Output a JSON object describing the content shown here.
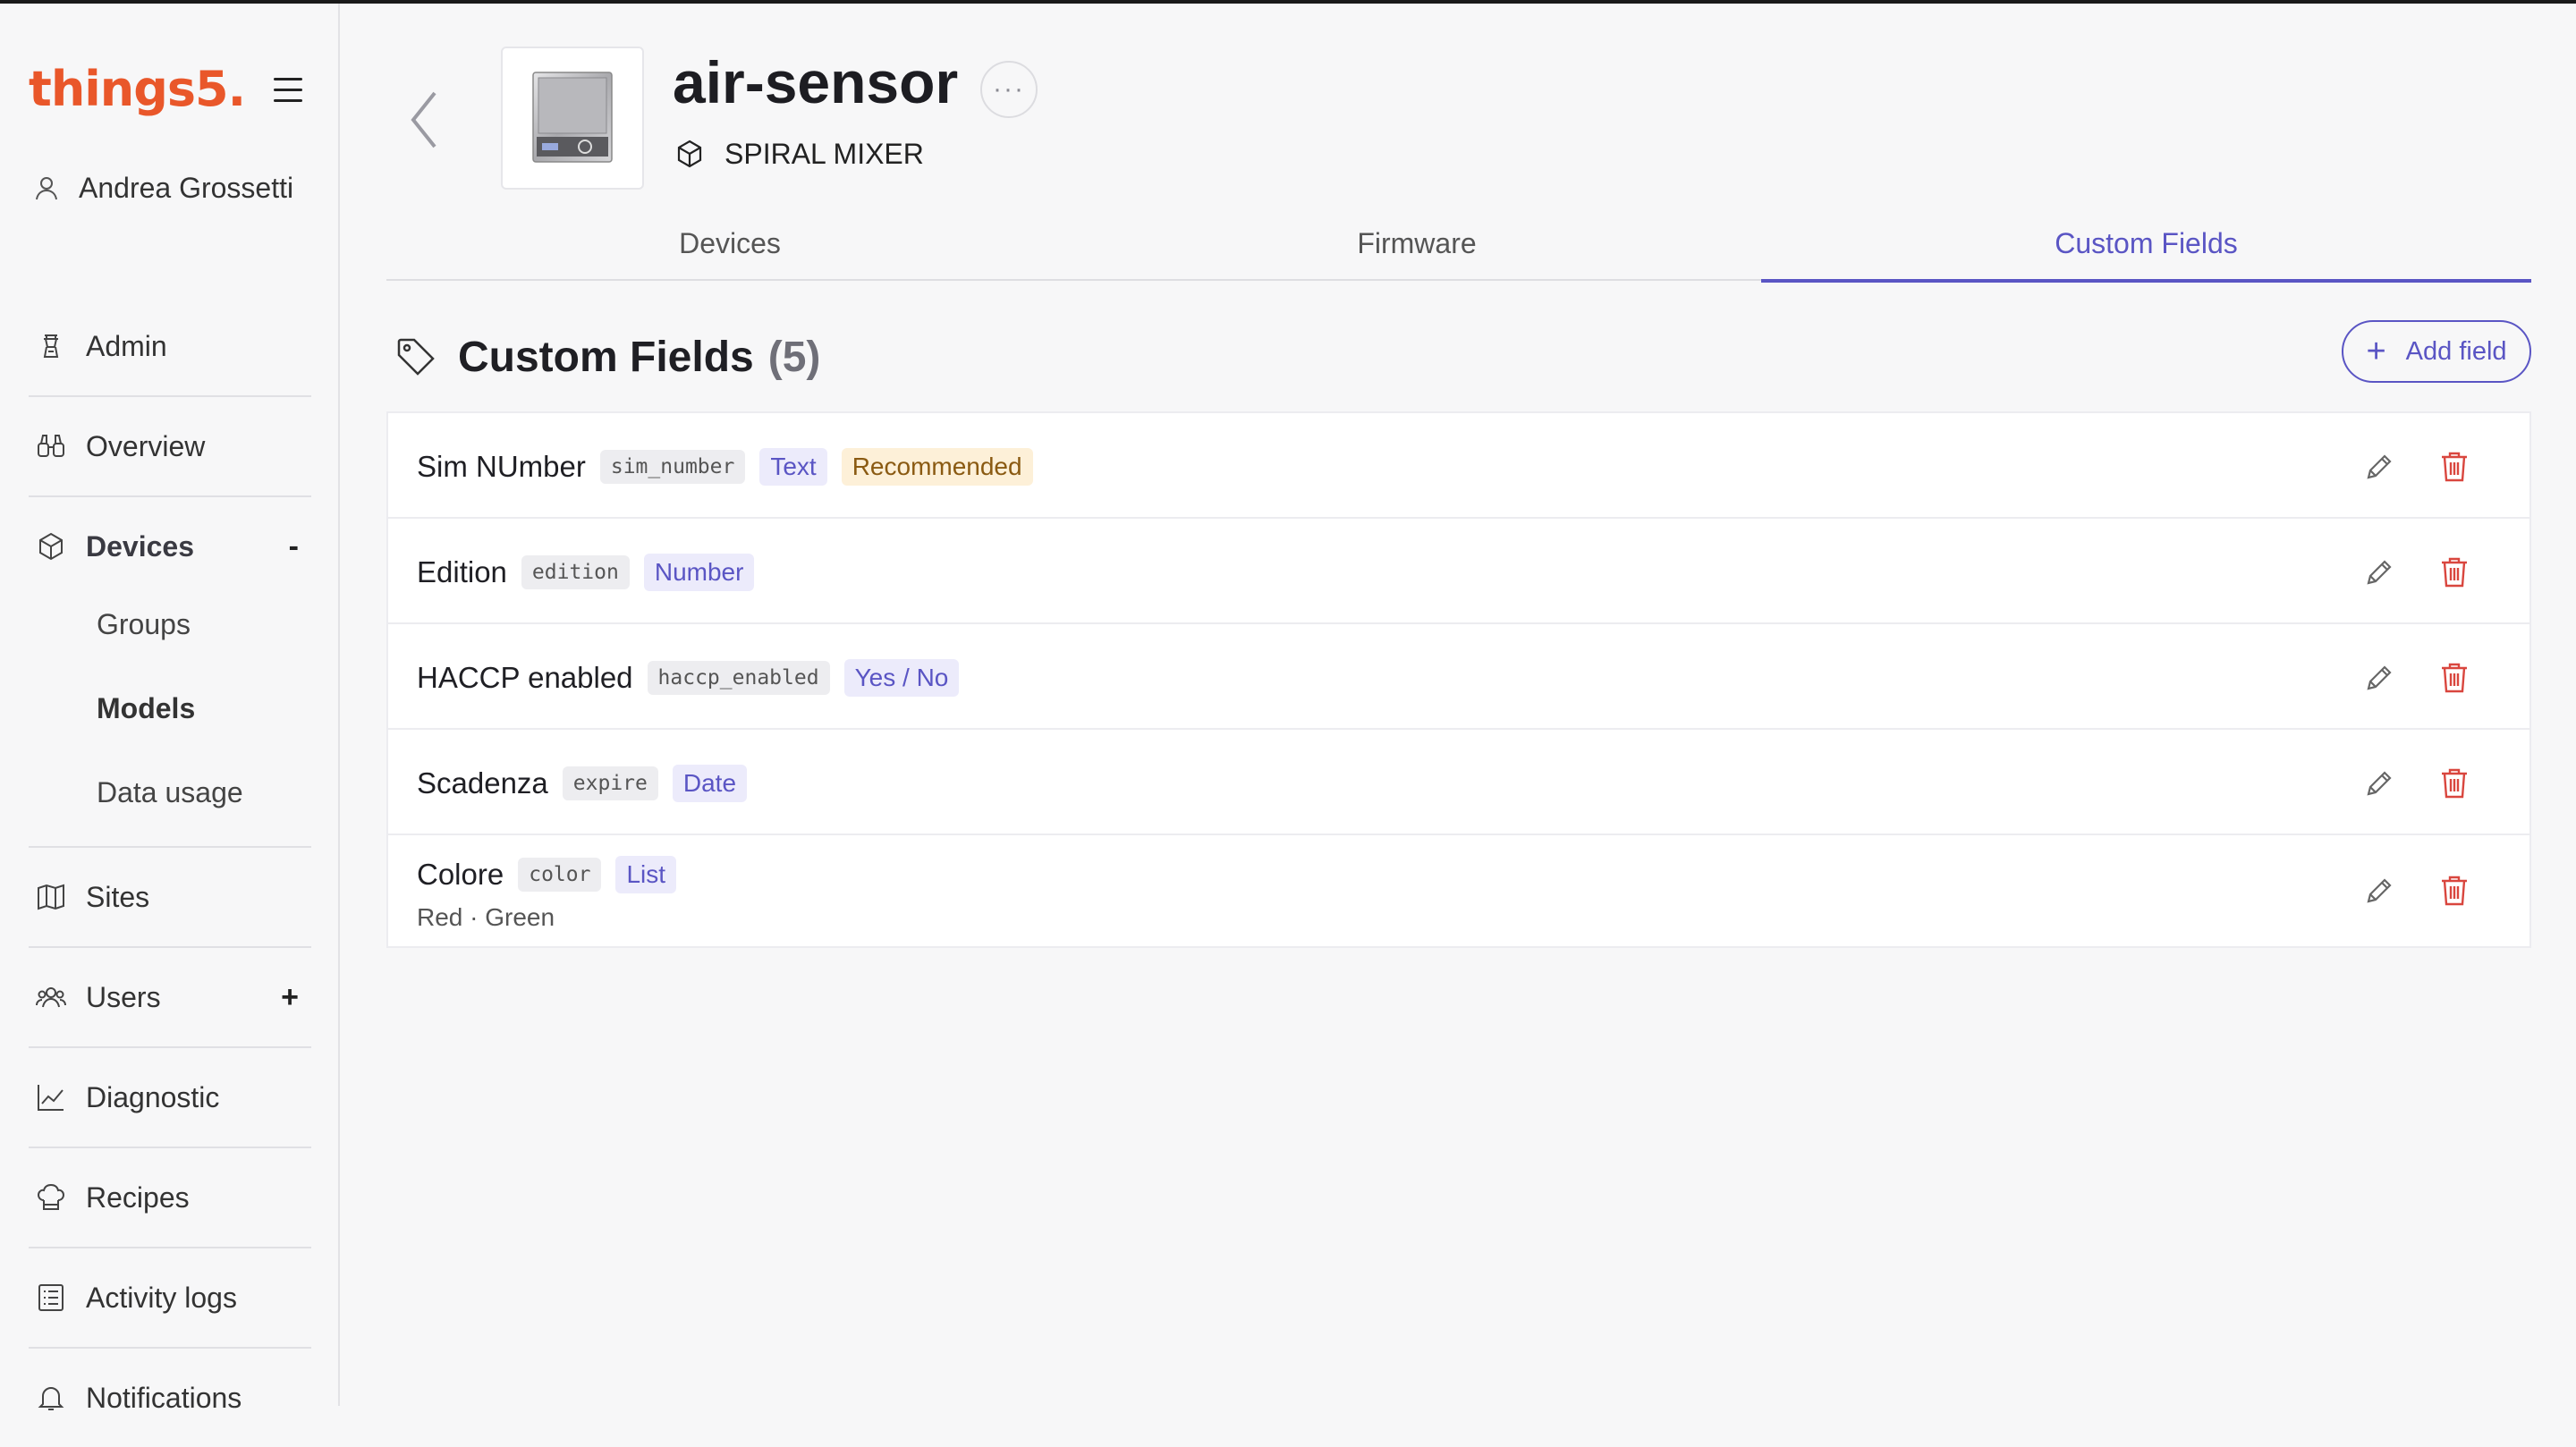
{
  "brand": {
    "logo_text": "things5.",
    "accent": "#e9572a"
  },
  "user": {
    "name": "Andrea Grossetti"
  },
  "nav": {
    "admin": "Admin",
    "overview": "Overview",
    "devices": "Devices",
    "devices_toggle": "-",
    "sub": {
      "groups": "Groups",
      "models": "Models",
      "data_usage": "Data usage"
    },
    "sites": "Sites",
    "users": "Users",
    "users_toggle": "+",
    "diagnostic": "Diagnostic",
    "recipes": "Recipes",
    "activity_logs": "Activity logs",
    "notifications": "Notifications"
  },
  "header": {
    "title": "air-sensor",
    "more": "···",
    "subtitle": "SPIRAL MIXER"
  },
  "tabs": {
    "devices": "Devices",
    "firmware": "Firmware",
    "custom_fields": "Custom Fields",
    "active": "custom_fields"
  },
  "section": {
    "title": "Custom Fields",
    "count": "(5)",
    "add_label": "Add field",
    "accent": "#5a55c4"
  },
  "fields": [
    {
      "name": "Sim NUmber",
      "key": "sim_number",
      "type": "Text",
      "tag": "Recommended"
    },
    {
      "name": "Edition",
      "key": "edition",
      "type": "Number"
    },
    {
      "name": "HACCP enabled",
      "key": "haccp_enabled",
      "type": "Yes / No"
    },
    {
      "name": "Scadenza",
      "key": "expire",
      "type": "Date"
    },
    {
      "name": "Colore",
      "key": "color",
      "type": "List",
      "options": "Red · Green"
    }
  ]
}
